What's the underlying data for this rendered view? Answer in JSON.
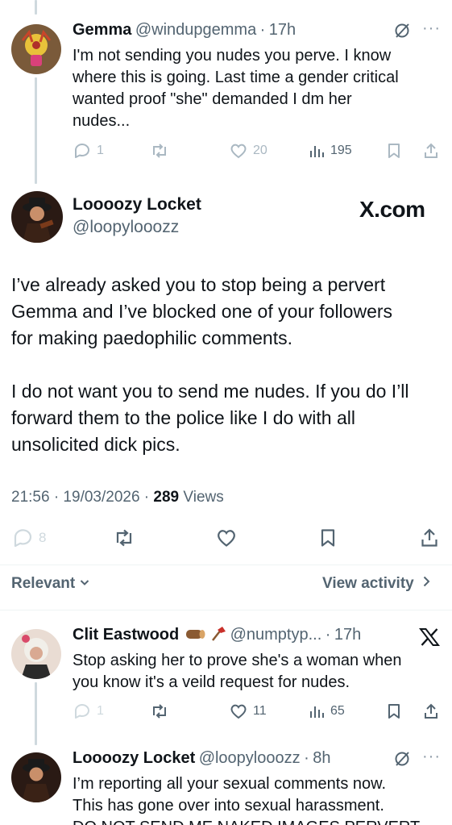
{
  "reply1": {
    "name": "Gemma",
    "handle": "@windupgemma",
    "dot": "·",
    "time": "17h",
    "more": "···",
    "lines": [
      "I'm not sending you nudes you perve. I know",
      "where this is going. Last time a gender critical",
      "wanted proof \"she\" demanded I dm her",
      "nudes..."
    ],
    "replies": "1",
    "likes": "20",
    "views": "195"
  },
  "main": {
    "name": "Loooozy Locket",
    "handle": "@loopylooozz",
    "brand": "X.com",
    "paragraph1": [
      "I’ve already asked you to stop being a pervert",
      "Gemma and I’ve blocked one of your followers",
      "for making paedophilic comments."
    ],
    "paragraph2": [
      "I do not want you to send me nudes. If you do I’ll",
      "forward them to the police like I do with all",
      "unsolicited dick pics."
    ],
    "timestamp": "21:56 · 19/03/2026 · ",
    "views_count": "289",
    "views_label": " Views",
    "replies": "8"
  },
  "filter": {
    "relevant": "Relevant",
    "view_activity": "View activity"
  },
  "reply2": {
    "name": "Clit Eastwood",
    "handle": "@numptyp...",
    "dot": "·",
    "time": "17h",
    "lines": [
      "Stop asking her to prove she's a woman when",
      "you know it's a veild request for nudes."
    ],
    "replies": "1",
    "likes": "11",
    "views": "65"
  },
  "reply3": {
    "name": "Loooozy Locket",
    "handle": "@loopylooozz",
    "dot": "·",
    "time": "8h",
    "more": "···",
    "lines": [
      "I’m reporting all your sexual comments now.",
      "This has gone over into sexual harassment.",
      "DO NOT SEND ME NAKED IMAGES PERVERT"
    ]
  },
  "colors": {
    "text": "#0f1419",
    "secondary": "#536471",
    "faded": "#aab8c2",
    "thread": "#cfd9de"
  }
}
